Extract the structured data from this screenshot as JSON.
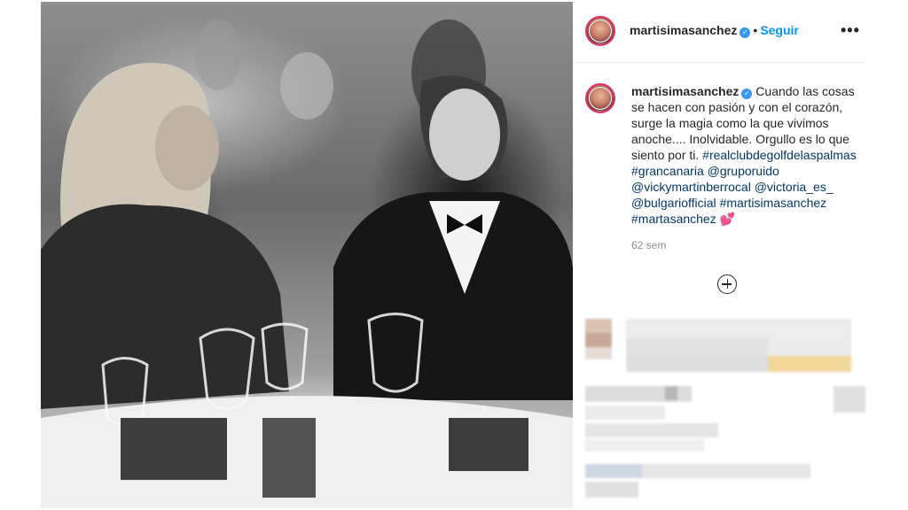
{
  "post": {
    "photo_alt": "Pareja sonriendo en una cena de gala",
    "author": {
      "username": "martisimasanchez",
      "verified": true,
      "follow_label": "Seguir",
      "separator": "•"
    },
    "caption": {
      "username": "martisimasanchez",
      "text": "Cuando las cosas se hacen con pasión y con el corazón, surge la magia como la que vivimos anoche.... Inolvidable. Orgullo es lo que siento por ti.",
      "tags": [
        "#realclubdegolfdelaspalmas",
        "#grancanaria",
        "@gruporuido",
        "@vickymartinberrocal",
        "@victoria_es_",
        "@bulgariofficial",
        "#martisimasanchez",
        "#martasanchez"
      ],
      "emoji": "💕"
    },
    "time_ago": "62 sem",
    "more_icon": "ellipsis-icon",
    "load_more_icon": "plus-circle-icon",
    "colors": {
      "follow": "#0095f6",
      "tag": "#00376b",
      "verified": "#3897f0",
      "meta": "#8e8e8e"
    }
  }
}
